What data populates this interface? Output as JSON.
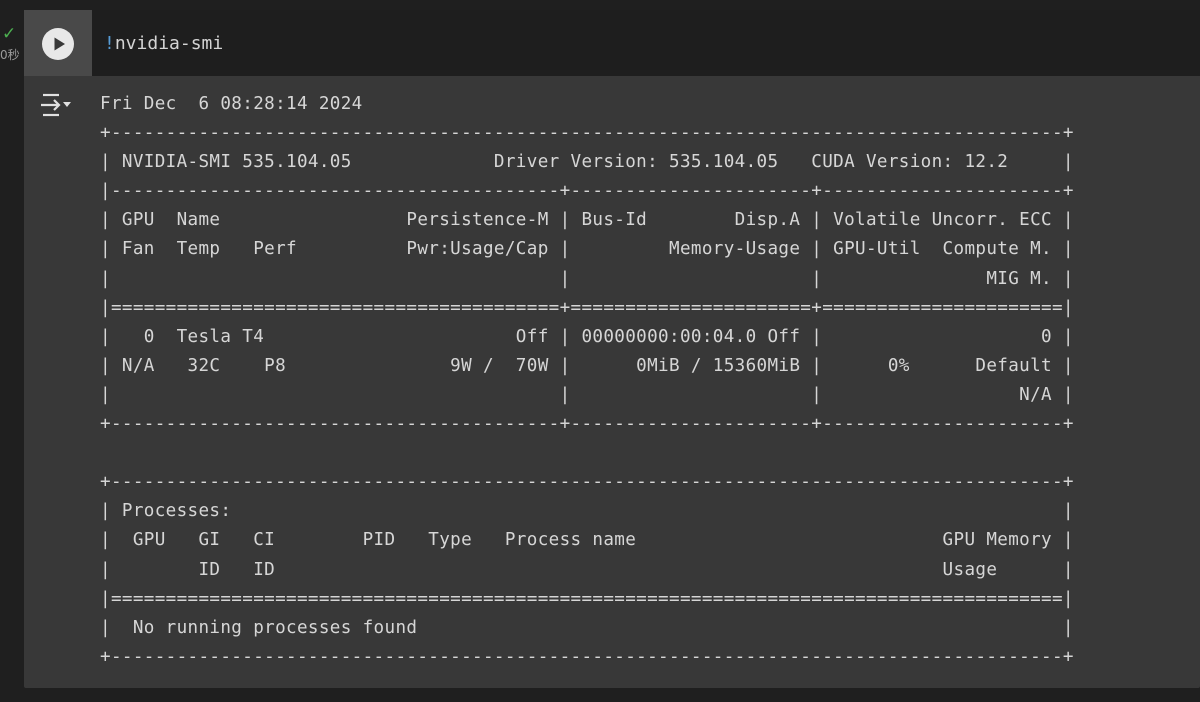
{
  "cell_status": {
    "check_glyph": "✓",
    "time_text": "0秒",
    "check_color": "#4caf50"
  },
  "code_cell": {
    "bang": "!",
    "command": "nvidia-smi"
  },
  "output": {
    "lines": [
      "Fri Dec  6 08:28:14 2024",
      "+---------------------------------------------------------------------------------------+",
      "| NVIDIA-SMI 535.104.05             Driver Version: 535.104.05   CUDA Version: 12.2     |",
      "|-----------------------------------------+----------------------+----------------------+",
      "| GPU  Name                 Persistence-M | Bus-Id        Disp.A | Volatile Uncorr. ECC |",
      "| Fan  Temp   Perf          Pwr:Usage/Cap |         Memory-Usage | GPU-Util  Compute M. |",
      "|                                         |                      |               MIG M. |",
      "|=========================================+======================+======================|",
      "|   0  Tesla T4                       Off | 00000000:00:04.0 Off |                    0 |",
      "| N/A   32C    P8               9W /  70W |      0MiB / 15360MiB |      0%      Default |",
      "|                                         |                      |                  N/A |",
      "+-----------------------------------------+----------------------+----------------------+",
      "",
      "+---------------------------------------------------------------------------------------+",
      "| Processes:                                                                            |",
      "|  GPU   GI   CI        PID   Type   Process name                            GPU Memory |",
      "|        ID   ID                                                             Usage      |",
      "|=======================================================================================|",
      "|  No running processes found                                                           |",
      "+---------------------------------------------------------------------------------------+"
    ]
  },
  "icons": {
    "run": "play-icon",
    "output_toggle": "output-toggle-icon"
  },
  "colors": {
    "cell_background": "#383838",
    "code_background": "#1e1e1e",
    "gutter_background": "#494949",
    "text": "#d6d6d6",
    "bang": "#569cd6"
  }
}
